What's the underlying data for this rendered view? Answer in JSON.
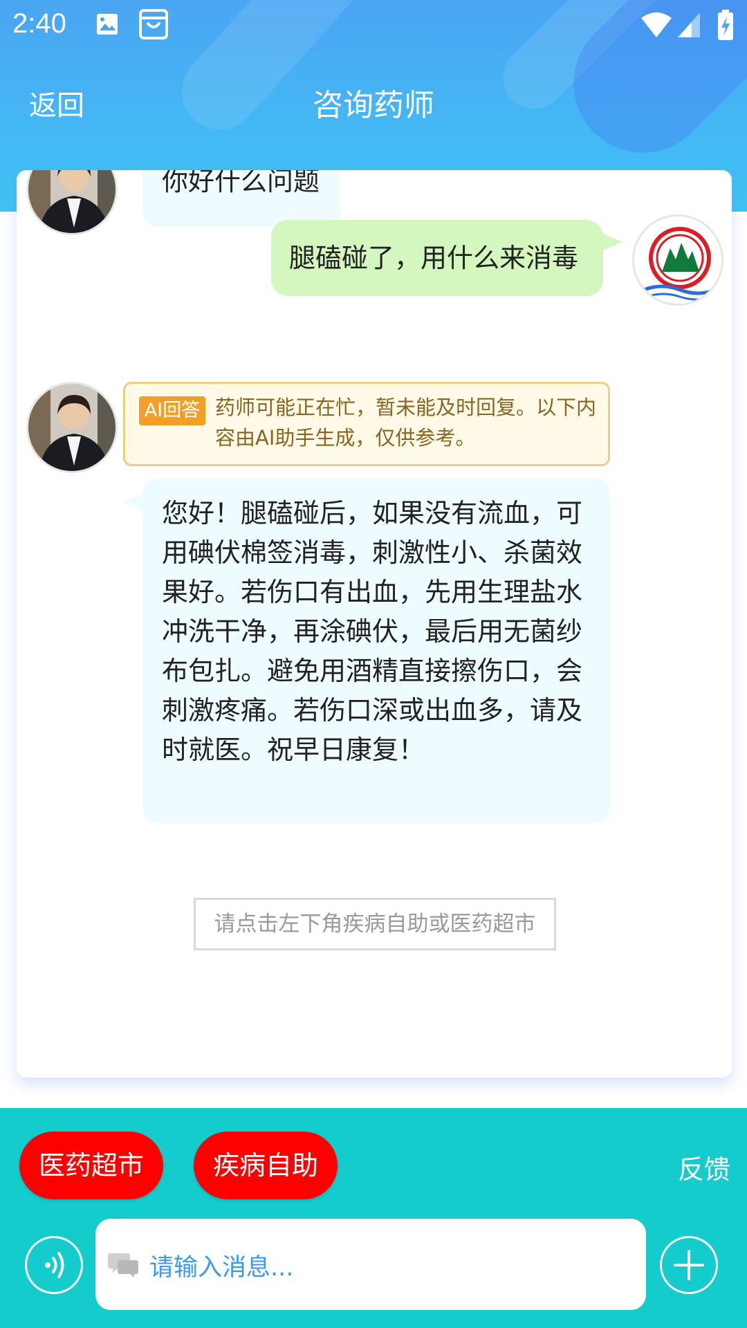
{
  "status_bar": {
    "time": "2:40"
  },
  "nav": {
    "back_label": "返回",
    "title": "咨询药师"
  },
  "chat": {
    "messages": [
      {
        "side": "left",
        "text": "你好什么问题"
      },
      {
        "side": "right",
        "text": "腿磕碰了，用什么来消毒"
      },
      {
        "side": "left",
        "ai_badge": "AI回答",
        "ai_notice": "药师可能正在忙，暂未能及时回复。以下内容由AI助手生成，仅供参考。",
        "text": "您好！腿磕碰后，如果没有流血，可用碘伏棉签消毒，刺激性小、杀菌效果好。若伤口有出血，先用生理盐水冲洗干净，再涂碘伏，最后用无菌纱布包扎。避免用酒精直接擦伤口，会刺激疼痛。若伤口深或出血多，请及时就医。祝早日康复！"
      }
    ],
    "hint": "请点击左下角疾病自助或医药超市"
  },
  "bottom": {
    "pharmacy_button": "医药超市",
    "self_help_button": "疾病自助",
    "feedback": "反馈",
    "input_placeholder": "请输入消息..."
  },
  "colors": {
    "header_gradient_top": "#4aa5f3",
    "bottom_bar": "#14cccc",
    "pill_button": "#ff0000",
    "user_bubble": "#d4f7bf",
    "pharmacist_bubble": "#eefbff",
    "ai_badge": "#f0a028"
  },
  "icons": {
    "status": [
      "image-icon",
      "shopping-bag-icon",
      "wifi-icon",
      "cellular-signal-icon",
      "battery-charging-icon"
    ],
    "input": [
      "chat-bubbles-icon",
      "voice-icon",
      "plus-icon"
    ]
  }
}
